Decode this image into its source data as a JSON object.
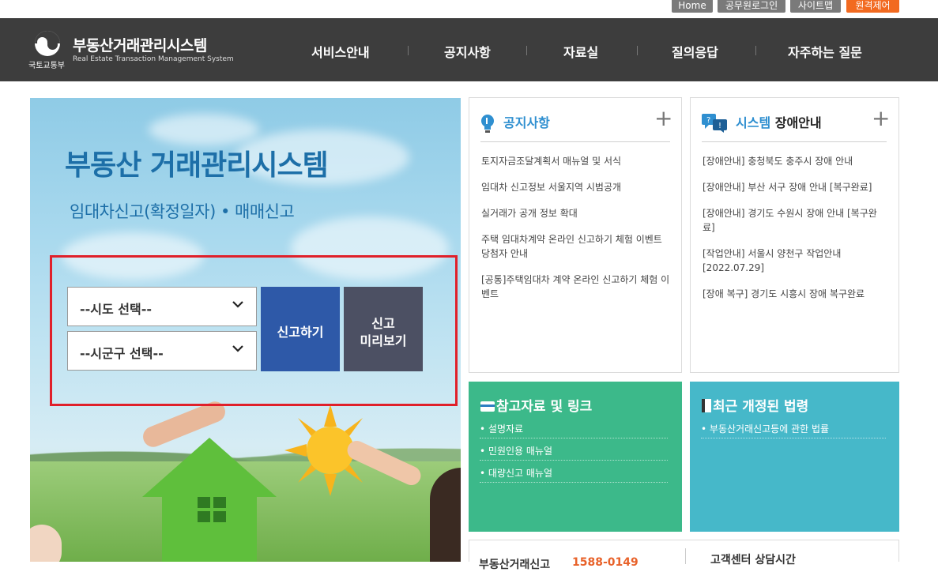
{
  "top_links": [
    {
      "label": "Home"
    },
    {
      "label": "공무원로그인"
    },
    {
      "label": "사이트맵"
    },
    {
      "label": "원격제어"
    }
  ],
  "header": {
    "ministry": "국토교통부",
    "title": "부동산거래관리시스템",
    "subtitle": "Real Estate Transaction Management System"
  },
  "nav": [
    {
      "label": "서비스안내"
    },
    {
      "label": "공지사항"
    },
    {
      "label": "자료실"
    },
    {
      "label": "질의응답"
    },
    {
      "label": "자주하는 질문"
    }
  ],
  "hero": {
    "title": "부동산 거래관리시스템",
    "subtitle": "임대차신고(확정일자) • 매매신고",
    "sido_select": "--시도 선택--",
    "sigungu_select": "--시군구 선택--",
    "report_button": "신고하기",
    "preview_button_line1": "신고",
    "preview_button_line2": "미리보기"
  },
  "notice": {
    "title": "공지사항",
    "plus": "+",
    "items": [
      "토지자금조달계획서 매뉴얼 및 서식",
      "임대차 신고정보 서울지역 시범공개",
      "실거래가 공개 정보 확대",
      "주택 임대차계약 온라인 신고하기 체험 이벤트 당첨자 안내",
      "[공통]주택임대차 계약 온라인 신고하기 체험 이벤트"
    ]
  },
  "outage": {
    "title_accent": "시스템",
    "title_rest": " 장애안내",
    "plus": "+",
    "items": [
      "[장애안내] 충청북도 충주시 장애 안내",
      "[장애안내] 부산 서구 장애 안내 [복구완료]",
      "[장애안내] 경기도 수원시 장애 안내 [복구완료]",
      "[작업안내] 서울시 양천구 작업안내 [2022.07.29]",
      "[장애 복구] 경기도 시흥시 장애 복구완료"
    ]
  },
  "references": {
    "title": "참고자료 및 링크",
    "items": [
      "설명자료",
      "민원인용 매뉴얼",
      "대량신고 매뉴얼"
    ]
  },
  "laws": {
    "title": "최근 개정된 법령",
    "items": [
      "부동산거래신고등에 관한 법률"
    ]
  },
  "bottom": {
    "left_label": "부동산거래신고",
    "left_phone": "1588-0149",
    "right_label": "고객센터 상담시간"
  },
  "colors": {
    "header_bg": "#3d3d3d",
    "accent_blue": "#2e59a8",
    "preview_gray": "#4c5063",
    "green_box": "#3cb98a",
    "teal_box": "#46b8c9",
    "highlight_red": "#e0202a",
    "orange_button": "#f26a20"
  }
}
